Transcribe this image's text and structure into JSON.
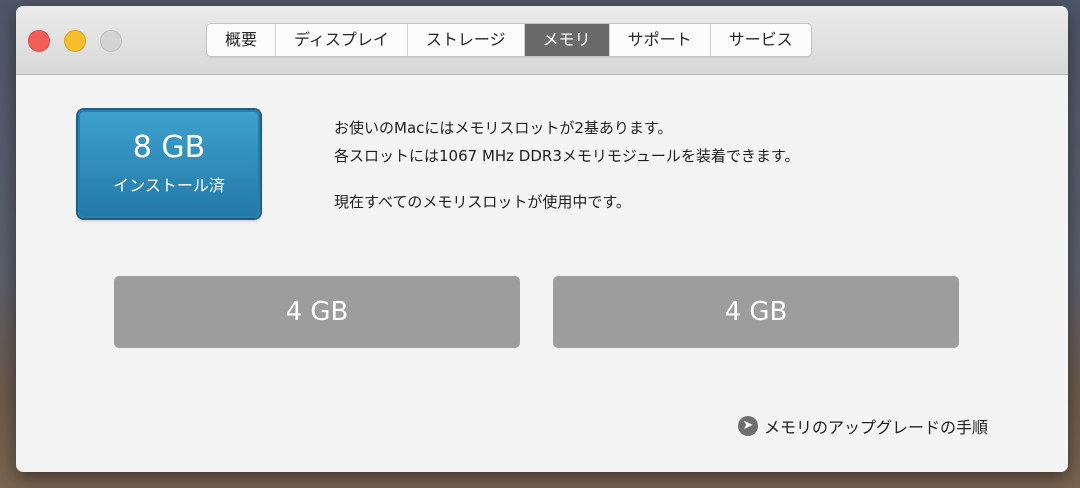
{
  "window": {
    "tabs": [
      {
        "label": "概要",
        "active": false
      },
      {
        "label": "ディスプレイ",
        "active": false
      },
      {
        "label": "ストレージ",
        "active": false
      },
      {
        "label": "メモリ",
        "active": true
      },
      {
        "label": "サポート",
        "active": false
      },
      {
        "label": "サービス",
        "active": false
      }
    ]
  },
  "memory": {
    "total_size": "8 GB",
    "total_label": "インストール済",
    "info_line1": "お使いのMacにはメモリスロットが2基あります。",
    "info_line2": "各スロットには1067 MHz DDR3メモリモジュールを装着できます。",
    "info_line3": "現在すべてのメモリスロットが使用中です。",
    "slots": [
      {
        "size": "4 GB"
      },
      {
        "size": "4 GB"
      }
    ],
    "upgrade_link": "メモリのアップグレードの手順"
  },
  "colors": {
    "badge_blue": "#2b8fc0",
    "slot_gray": "#9d9d9d",
    "active_tab": "#6a6a6a"
  }
}
